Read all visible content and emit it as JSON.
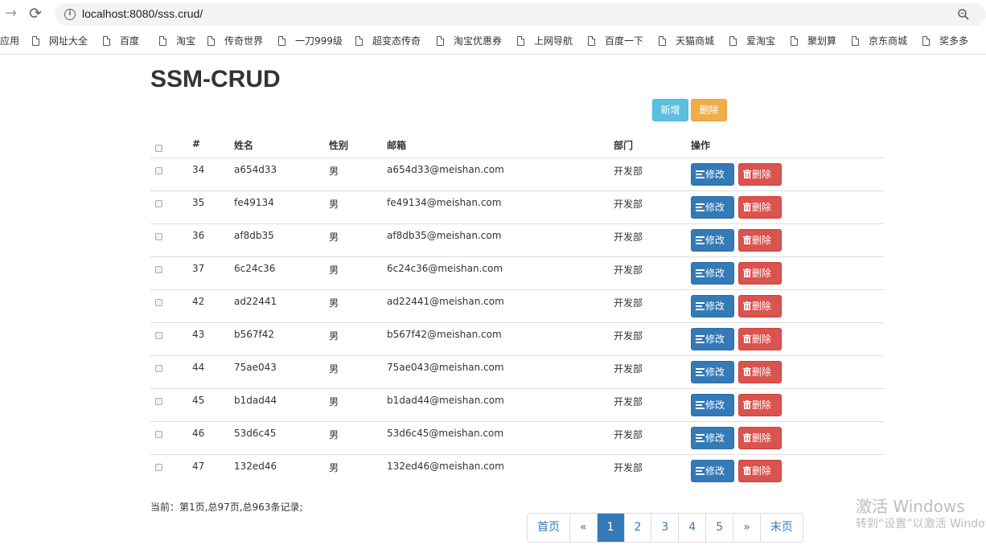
{
  "browser": {
    "url": "localhost:8080/sss.crud/",
    "bookmarks": [
      "应用",
      "网址大全",
      "百度",
      "淘宝",
      "传奇世界",
      "一刀999级",
      "超变态传奇",
      "淘宝优惠券",
      "上网导航",
      "百度一下",
      "天猫商城",
      "爱淘宝",
      "聚划算",
      "京东商城",
      "奖多多"
    ]
  },
  "page": {
    "title": "SSM-CRUD",
    "add_label": "新增",
    "delete_label": "删除"
  },
  "table": {
    "headers": [
      "#",
      "姓名",
      "性别",
      "邮箱",
      "部门",
      "操作"
    ],
    "edit_label": "修改",
    "delete_label": "删除",
    "rows": [
      {
        "id": "34",
        "name": "a654d33",
        "gender": "男",
        "email": "a654d33@meishan.com",
        "dept": "开发部"
      },
      {
        "id": "35",
        "name": "fe49134",
        "gender": "男",
        "email": "fe49134@meishan.com",
        "dept": "开发部"
      },
      {
        "id": "36",
        "name": "af8db35",
        "gender": "男",
        "email": "af8db35@meishan.com",
        "dept": "开发部"
      },
      {
        "id": "37",
        "name": "6c24c36",
        "gender": "男",
        "email": "6c24c36@meishan.com",
        "dept": "开发部"
      },
      {
        "id": "42",
        "name": "ad22441",
        "gender": "男",
        "email": "ad22441@meishan.com",
        "dept": "开发部"
      },
      {
        "id": "43",
        "name": "b567f42",
        "gender": "男",
        "email": "b567f42@meishan.com",
        "dept": "开发部"
      },
      {
        "id": "44",
        "name": "75ae043",
        "gender": "男",
        "email": "75ae043@meishan.com",
        "dept": "开发部"
      },
      {
        "id": "45",
        "name": "b1dad44",
        "gender": "男",
        "email": "b1dad44@meishan.com",
        "dept": "开发部"
      },
      {
        "id": "46",
        "name": "53d6c45",
        "gender": "男",
        "email": "53d6c45@meishan.com",
        "dept": "开发部"
      },
      {
        "id": "47",
        "name": "132ed46",
        "gender": "男",
        "email": "132ed46@meishan.com",
        "dept": "开发部"
      }
    ]
  },
  "footer": {
    "info": "当前：第1页,总97页,总963条记录;"
  },
  "pagination": {
    "items": [
      "首页",
      "«",
      "1",
      "2",
      "3",
      "4",
      "5",
      "»",
      "末页"
    ],
    "active": "1"
  },
  "watermark": {
    "line1": "激活 Windows",
    "line2": "转到“设置”以激活 Windows"
  },
  "colors": {
    "primary": "#337ab7",
    "danger": "#d9534f",
    "info": "#5bc0de",
    "warning": "#f0ad4e"
  }
}
